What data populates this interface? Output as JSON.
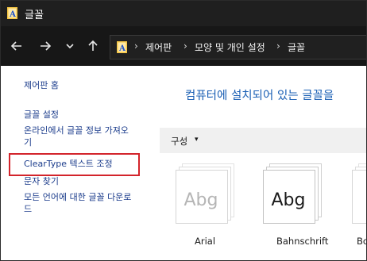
{
  "window": {
    "title": "글꼴"
  },
  "address_bar": {
    "crumbs": [
      "제어판",
      "모양 및 개인 설정",
      "글꼴"
    ]
  },
  "sidebar": {
    "home": "제어판 홈",
    "items": [
      {
        "label_line1": "글꼴 설정",
        "label_line2": ""
      },
      {
        "label_line1": "온라인에서 글꼴 정보 가져오",
        "label_line2": "기"
      },
      {
        "label_line1": "ClearType 텍스트 조정",
        "label_line2": ""
      },
      {
        "label_line1": "문자 찾기",
        "label_line2": ""
      },
      {
        "label_line1": "모든 언어에 대한 글꼴 다운로",
        "label_line2": "드"
      }
    ]
  },
  "main": {
    "title": "컴퓨터에 설치되어 있는 글꼴을",
    "toolbar": {
      "organize": "구성",
      "caret": "▾"
    },
    "fonts": [
      {
        "preview": "Abg",
        "name": "Arial",
        "selected": false
      },
      {
        "preview": "Abg",
        "name": "Bahnschrift",
        "selected": true
      },
      {
        "preview": "",
        "name": "Bo",
        "selected": false
      }
    ]
  },
  "colors": {
    "titlebar": "#1f1f1f",
    "navbar": "#171717",
    "link": "#1c3d8c",
    "heading": "#1a5fb4",
    "highlight": "#d3242b"
  }
}
